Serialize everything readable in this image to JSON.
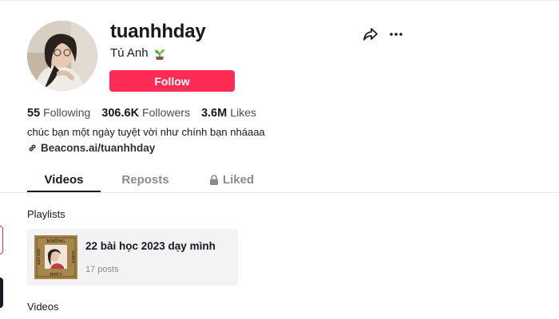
{
  "profile": {
    "username": "tuanhhday",
    "nickname": "Tú Anh",
    "nickname_icon": "sprout-icon",
    "follow_label": "Follow",
    "stats": [
      {
        "number": "55",
        "label": "Following"
      },
      {
        "number": "306.6K",
        "label": "Followers"
      },
      {
        "number": "3.6M",
        "label": "Likes"
      }
    ],
    "bio": "chúc bạn một ngày tuyệt vời như chính bạn nháaaa",
    "link": "Beacons.ai/tuanhhday"
  },
  "actions": {
    "share_icon": "share-arrow-icon",
    "more_icon": "more-horizontal-icon"
  },
  "tabs": [
    {
      "label": "Videos",
      "active": true
    },
    {
      "label": "Reposts",
      "active": false
    },
    {
      "label": "Liked",
      "active": false,
      "icon": "lock-icon"
    }
  ],
  "playlists": {
    "title": "Playlists",
    "items": [
      {
        "name": "22 bài học 2023 dạy mình",
        "posts": "17 posts",
        "thumb_text": [
          "KHÔNG",
          "AI ĐẾN",
          "CẠNH",
          "BẠN MÃI"
        ]
      }
    ]
  },
  "videos_section": {
    "title": "Videos"
  },
  "colors": {
    "accent": "#fe2c55",
    "text": "#161823",
    "muted": "#8a8b91",
    "card_bg": "#f3f3f4"
  }
}
